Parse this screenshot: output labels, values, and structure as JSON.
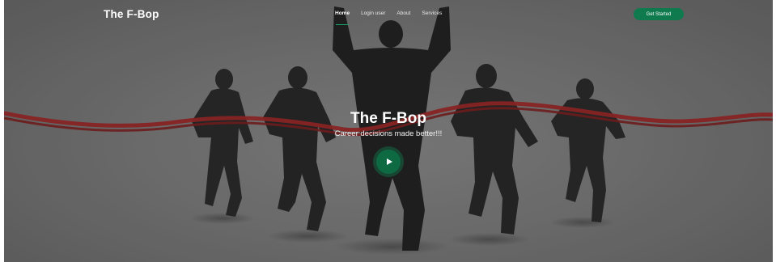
{
  "brand": "The F-Bop",
  "nav": {
    "items": [
      {
        "label": "Home",
        "active": true
      },
      {
        "label": "Login user"
      },
      {
        "label": "About"
      },
      {
        "label": "Services"
      }
    ],
    "cta_label": "Get Started"
  },
  "hero": {
    "title": "The F-Bop",
    "subtitle": "Career decisions made better!!!",
    "play_icon": "play-icon"
  },
  "colors": {
    "accent": "#0f7a4e",
    "ribbon": "#8b1a1a",
    "overlay": "#666666"
  }
}
